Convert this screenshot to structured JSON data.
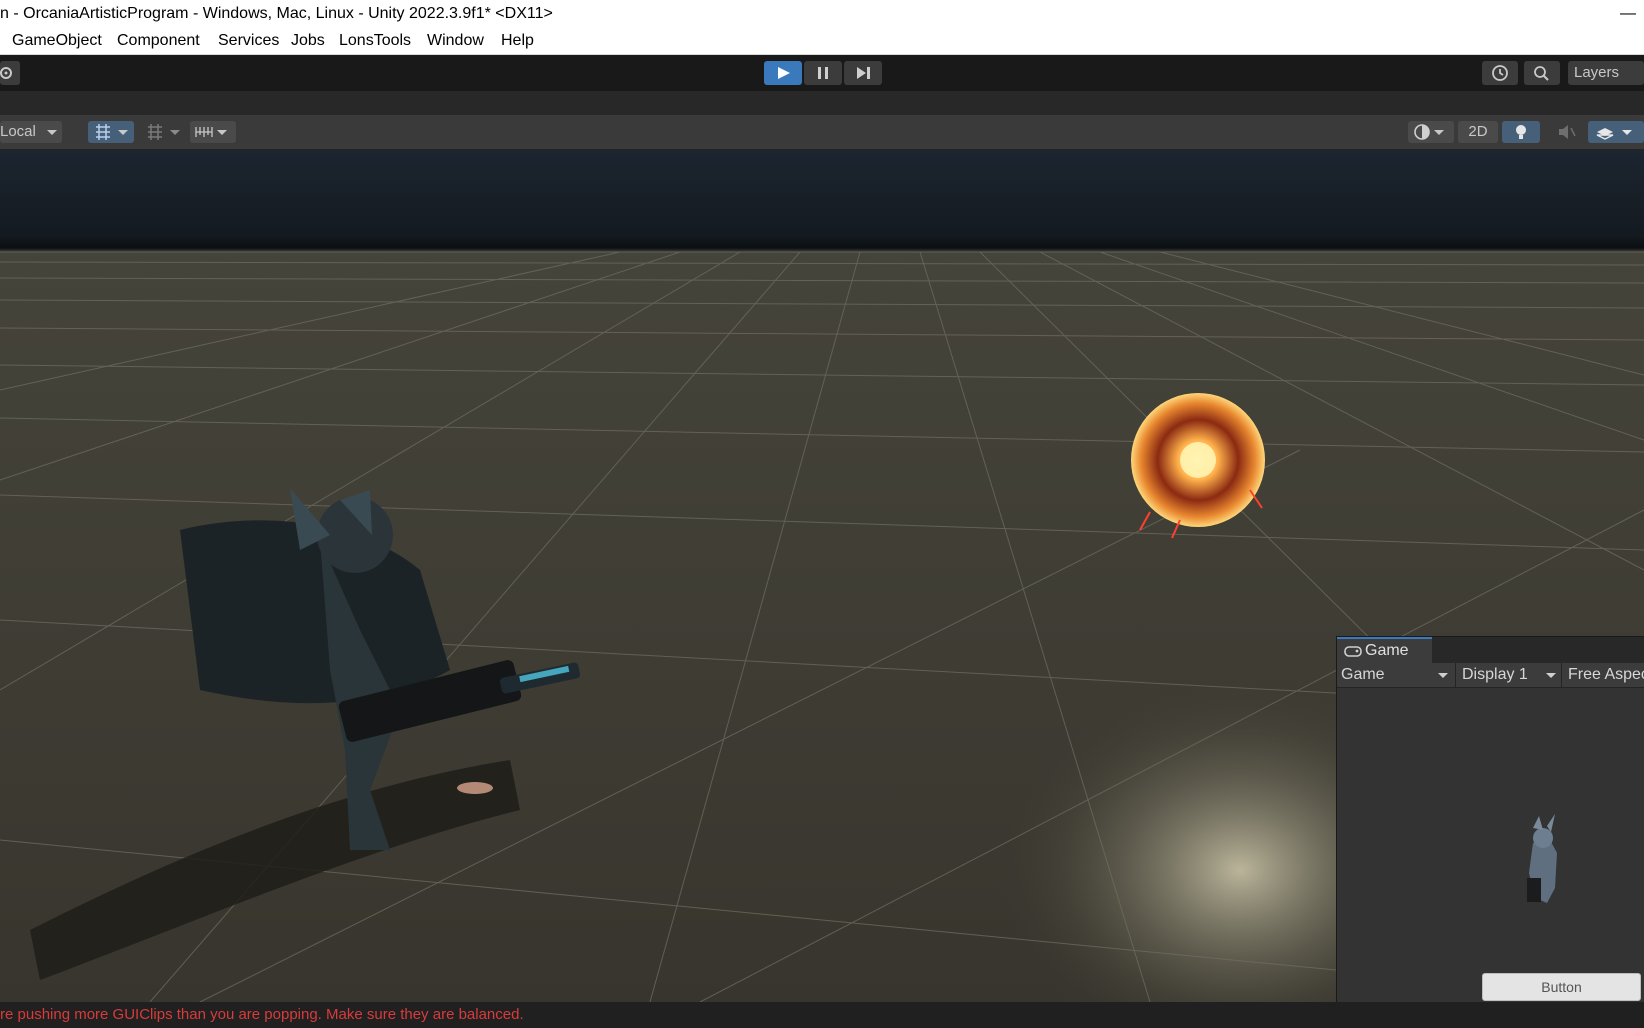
{
  "window": {
    "title": "n - OrcaniaArtisticProgram - Windows, Mac, Linux - Unity 2022.3.9f1* <DX11>",
    "minimize": "—"
  },
  "menubar": {
    "items": [
      "GameObject",
      "Component",
      "Services",
      "Jobs",
      "LonsTools",
      "Window",
      "Help"
    ]
  },
  "toolbar": {
    "layers_label": "Layers",
    "accent": "#3a79bb"
  },
  "scene_toolbar": {
    "pivot_label": "Local",
    "mode_2d_label": "2D"
  },
  "game_window": {
    "tab_label": "Game",
    "view_select": "Game",
    "display_select": "Display 1",
    "aspect_select": "Free Aspec",
    "button_label": "Button"
  },
  "console": {
    "message": "re pushing more GUIClips than you are popping. Make sure they are balanced.",
    "color": "#d83b3b"
  }
}
